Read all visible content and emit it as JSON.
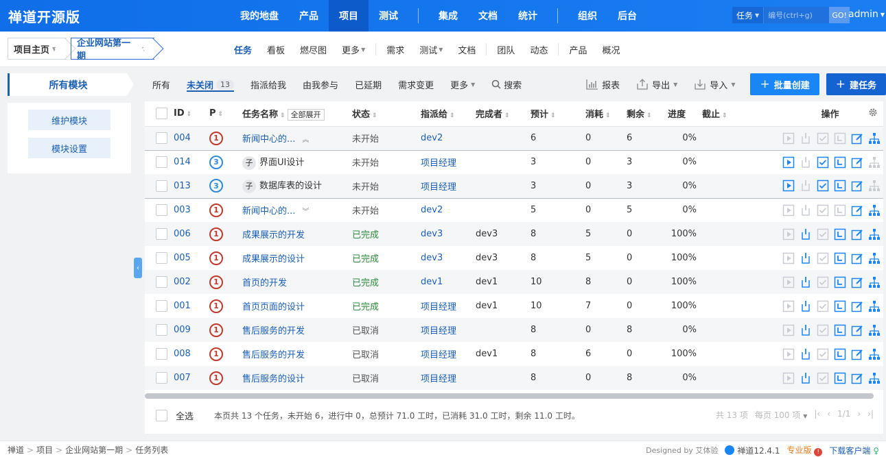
{
  "header": {
    "brand": "禅道开源版",
    "nav": [
      "我的地盘",
      "产品",
      "项目",
      "测试",
      "集成",
      "文档",
      "统计",
      "组织",
      "后台"
    ],
    "active_index": 2,
    "search_type": "任务",
    "search_placeholder": "编号(ctrl+g)",
    "search_go": "GO!",
    "user": "admin"
  },
  "subbar": {
    "crumb_home": "项目主页",
    "crumb_project": "企业网站第一期",
    "nav": [
      "任务",
      "看板",
      "燃尽图",
      "更多",
      "需求",
      "测试",
      "文档",
      "团队",
      "动态",
      "产品",
      "概况"
    ],
    "active": "任务"
  },
  "modules": {
    "title": "所有模块",
    "maintain": "维护模块",
    "settings": "模块设置"
  },
  "featurebar": {
    "all": "所有",
    "unclosed": "未关闭",
    "unclosed_count": "13",
    "assigned": "指派给我",
    "involved": "由我参与",
    "delayed": "已延期",
    "changed": "需求变更",
    "more": "更多",
    "search": "搜索",
    "report": "报表",
    "export": "导出",
    "import": "导入",
    "batch_create": "批量创建",
    "create": "建任务"
  },
  "table": {
    "headers": {
      "id": "ID",
      "pri": "P",
      "name": "任务名称",
      "expand_all": "全部展开",
      "status": "状态",
      "assigned": "指派给",
      "finished_by": "完成者",
      "estimate": "预计",
      "consumed": "消耗",
      "left": "剩余",
      "progress": "进度",
      "deadline": "截止",
      "actions": "操作"
    },
    "rows": [
      {
        "id": "004",
        "pri": "1",
        "name": "新闻中心的...",
        "status": "未开始",
        "assigned": "dev2",
        "finished_by": "",
        "estimate": "6",
        "consumed": "0",
        "left": "6",
        "progress": "0%",
        "parent": true
      },
      {
        "id": "014",
        "pri": "3",
        "name": "界面UI设计",
        "sub": "子",
        "status": "未开始",
        "assigned": "项目经理",
        "finished_by": "",
        "estimate": "3",
        "consumed": "0",
        "left": "3",
        "progress": "0%"
      },
      {
        "id": "013",
        "pri": "3",
        "name": "数据库表的设计",
        "sub": "子",
        "status": "未开始",
        "assigned": "项目经理",
        "finished_by": "",
        "estimate": "3",
        "consumed": "0",
        "left": "3",
        "progress": "0%"
      },
      {
        "id": "003",
        "pri": "1",
        "name": "新闻中心的...",
        "status": "未开始",
        "assigned": "dev2",
        "finished_by": "",
        "estimate": "5",
        "consumed": "0",
        "left": "5",
        "progress": "0%",
        "parent": true
      },
      {
        "id": "006",
        "pri": "1",
        "name": "成果展示的开发",
        "status": "已完成",
        "assigned": "dev3",
        "finished_by": "dev3",
        "estimate": "8",
        "consumed": "5",
        "left": "0",
        "progress": "100%"
      },
      {
        "id": "005",
        "pri": "1",
        "name": "成果展示的设计",
        "status": "已完成",
        "assigned": "dev3",
        "finished_by": "dev3",
        "estimate": "8",
        "consumed": "5",
        "left": "0",
        "progress": "100%"
      },
      {
        "id": "002",
        "pri": "1",
        "name": "首页的开发",
        "status": "已完成",
        "assigned": "dev1",
        "finished_by": "dev1",
        "estimate": "10",
        "consumed": "8",
        "left": "0",
        "progress": "100%"
      },
      {
        "id": "001",
        "pri": "1",
        "name": "首页页面的设计",
        "status": "已完成",
        "assigned": "项目经理",
        "finished_by": "dev1",
        "estimate": "10",
        "consumed": "7",
        "left": "0",
        "progress": "100%"
      },
      {
        "id": "009",
        "pri": "1",
        "name": "售后服务的开发",
        "status": "已取消",
        "assigned": "项目经理",
        "finished_by": "",
        "estimate": "8",
        "consumed": "0",
        "left": "8",
        "progress": "0%"
      },
      {
        "id": "008",
        "pri": "1",
        "name": "售后服务的开发",
        "status": "已取消",
        "assigned": "项目经理",
        "finished_by": "dev1",
        "estimate": "8",
        "consumed": "6",
        "left": "0",
        "progress": "100%"
      },
      {
        "id": "007",
        "pri": "1",
        "name": "售后服务的设计",
        "status": "已取消",
        "assigned": "项目经理",
        "finished_by": "",
        "estimate": "8",
        "consumed": "0",
        "left": "8",
        "progress": "0%"
      }
    ]
  },
  "foot": {
    "select_all": "全选",
    "summary": "本页共 13 个任务，未开始 6，进行中 0，总预计 71.0 工时，已消耗 31.0 工时，剩余 11.0 工时。",
    "total": "共 13 项",
    "per_page": "每页 100 项",
    "page": "1/1"
  },
  "footer": {
    "breadcrumb": [
      "禅道",
      "项目",
      "企业网站第一期",
      "任务列表"
    ],
    "designed_by": "Designed by 艾体验",
    "version": "禅道12.4.1",
    "pro": "专业版",
    "download": "下载客户端"
  },
  "colors": {
    "primary": "#1a86f5",
    "header": "#0f6ee8",
    "done": "#2e8b3d",
    "pri1": "#c0392b",
    "pri3": "#2e8bd8"
  }
}
